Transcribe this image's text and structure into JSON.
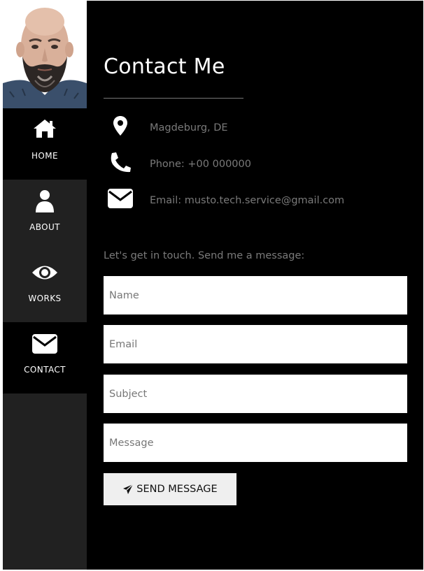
{
  "nav": {
    "items": [
      {
        "label": "HOME",
        "icon": "home-icon"
      },
      {
        "label": "ABOUT",
        "icon": "user-icon"
      },
      {
        "label": "WORKS",
        "icon": "eye-icon"
      },
      {
        "label": "CONTACT",
        "icon": "envelope-icon"
      }
    ],
    "active": "CONTACT"
  },
  "contact": {
    "title": "Contact Me",
    "location": "Magdeburg, DE",
    "phone": "Phone: +00 000000",
    "email": "Email: musto.tech.service@gmail.com",
    "intro": "Let's get in touch. Send me a message:"
  },
  "form": {
    "name_placeholder": "Name",
    "email_placeholder": "Email",
    "subject_placeholder": "Subject",
    "message_placeholder": "Message",
    "send_label": "SEND MESSAGE"
  },
  "colors": {
    "background": "#000000",
    "sidebar": "#212121",
    "muted_text": "#7a7a7a",
    "button": "#efefef"
  }
}
